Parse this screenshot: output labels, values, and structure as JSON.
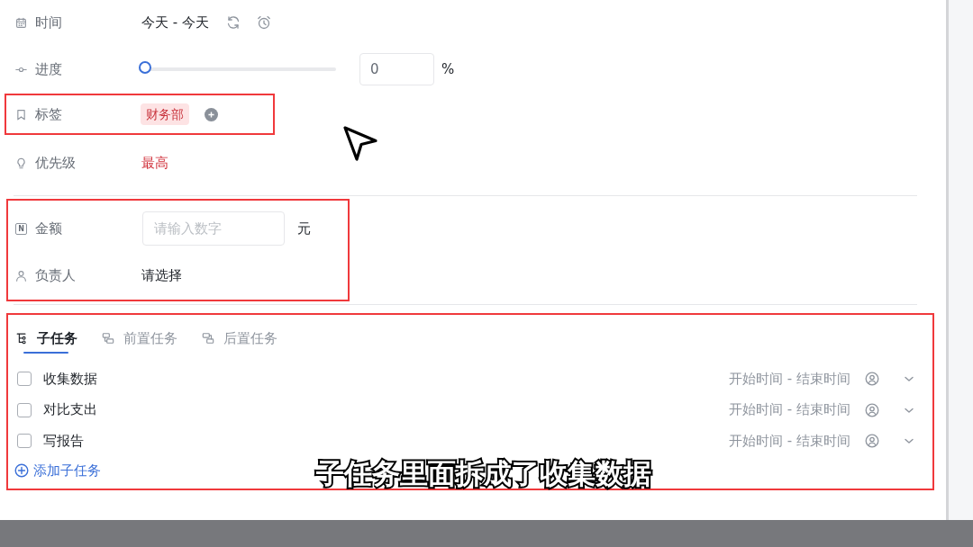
{
  "details": {
    "fields": [
      {
        "kind": "date_range",
        "label": "时间",
        "value": "今天 - 今天"
      },
      {
        "kind": "progress",
        "label": "进度",
        "level": 0,
        "value": "0",
        "unit": "%"
      },
      {
        "kind": "tags",
        "label": "标签",
        "annotated": true,
        "tags": [
          "财务部"
        ]
      },
      {
        "kind": "priority",
        "label": "优先级",
        "value": "最高"
      }
    ]
  },
  "custom_fields": {
    "annotated": true,
    "fields": [
      {
        "kind": "number",
        "icon_text": "N",
        "label": "金额",
        "placeholder": "请输入数字",
        "unit": "元"
      },
      {
        "kind": "person",
        "label": "负责人",
        "value": "请选择"
      }
    ]
  },
  "subtasks": {
    "annotated": true,
    "tabs": [
      {
        "label": "子任务",
        "selected": true
      },
      {
        "label": "前置任务",
        "selected": false
      },
      {
        "label": "后置任务",
        "selected": false
      }
    ],
    "items": [
      {
        "title": "收集数据",
        "checked": false,
        "dates": "开始时间 - 结束时间"
      },
      {
        "title": "对比支出",
        "checked": false,
        "dates": "开始时间 - 结束时间"
      },
      {
        "title": "写报告",
        "checked": false,
        "dates": "开始时间 - 结束时间"
      }
    ],
    "add_label": "添加子任务"
  },
  "caption": "子任务里面拆成了收集数据"
}
